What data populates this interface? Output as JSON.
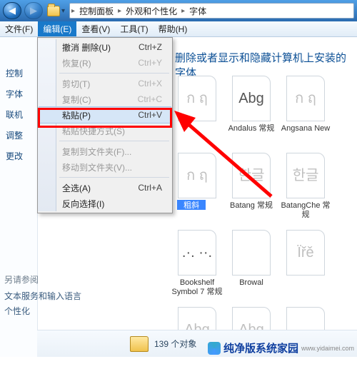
{
  "breadcrumb": {
    "seg1": "控制面板",
    "seg2": "外观和个性化",
    "seg3": "字体"
  },
  "menubar": {
    "file": "文件(F)",
    "edit": "编辑(E)",
    "view": "查看(V)",
    "tools": "工具(T)",
    "help": "帮助(H)"
  },
  "edit_menu": {
    "undo": {
      "label": "撤消 删除(U)",
      "shortcut": "Ctrl+Z"
    },
    "redo": {
      "label": "恢复(R)",
      "shortcut": "Ctrl+Y"
    },
    "cut": {
      "label": "剪切(T)",
      "shortcut": "Ctrl+X"
    },
    "copy": {
      "label": "复制(C)",
      "shortcut": "Ctrl+C"
    },
    "paste": {
      "label": "粘贴(P)",
      "shortcut": "Ctrl+V"
    },
    "paste_link": {
      "label": "粘贴快捷方式(S)"
    },
    "copy_to": {
      "label": "复制到文件夹(F)..."
    },
    "move_to": {
      "label": "移动到文件夹(V)..."
    },
    "select_all": {
      "label": "全选(A)",
      "shortcut": "Ctrl+A"
    },
    "invert": {
      "label": "反向选择(I)"
    }
  },
  "sidebar": {
    "items": [
      "控制",
      "字体",
      "联机",
      "调整",
      "更改"
    ]
  },
  "instruction": "删除或者显示和隐藏计算机上安装的字体",
  "fonts": [
    {
      "label": "",
      "glyph": "ก ฤ",
      "dim": true
    },
    {
      "label": "Andalus 常规",
      "glyph": "Abg",
      "dim": false
    },
    {
      "label": "Angsana New",
      "glyph": "ก ฤ",
      "dim": true
    },
    {
      "label": "",
      "glyph": "ก ฤ",
      "dim": true
    },
    {
      "label": "Batang 常规",
      "glyph": "한글",
      "dim": true
    },
    {
      "label": "BatangChe 常规",
      "glyph": "한글",
      "dim": true
    },
    {
      "label": "Bookshelf Symbol 7 常规",
      "glyph": ".·. ··.",
      "dim": false
    },
    {
      "label": "Browal",
      "glyph": "",
      "dim": true
    },
    {
      "label": "",
      "glyph": "Ïřě",
      "dim": true
    },
    {
      "label": "",
      "glyph": "Abg",
      "dim": true
    },
    {
      "label": "",
      "glyph": "Abg",
      "dim": true
    },
    {
      "label": "",
      "glyph": "",
      "dim": true
    }
  ],
  "related": {
    "header": "另请参阅",
    "link1": "文本服务和输入语言",
    "link2": "个性化"
  },
  "status": {
    "count": "139 个对象"
  },
  "highlight_text": "粗斜",
  "watermark": {
    "brand": "纯净版系统家园",
    "url": "www.yidaimei.com"
  }
}
